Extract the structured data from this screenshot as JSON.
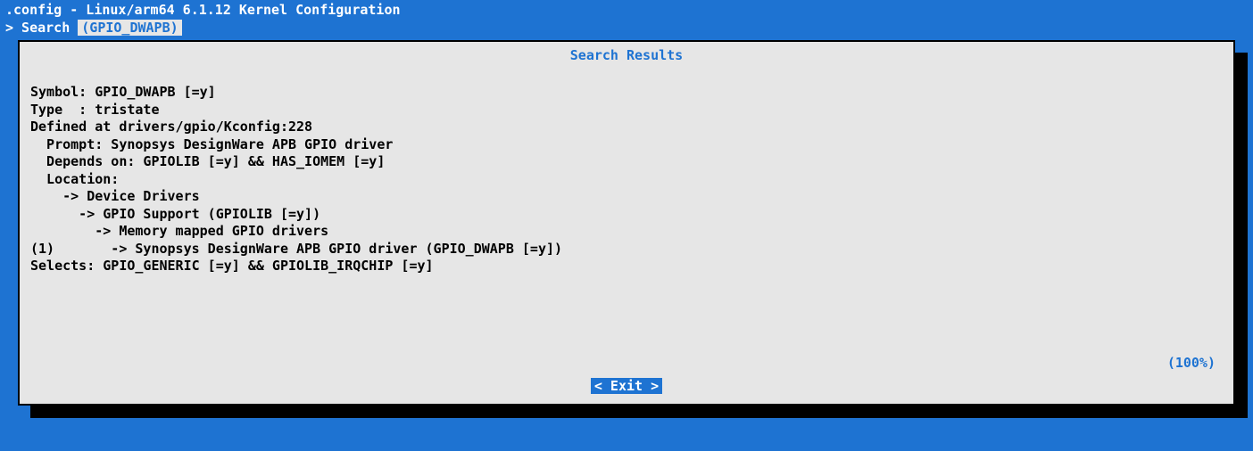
{
  "title": ".config - Linux/arm64 6.1.12 Kernel Configuration",
  "breadcrumb_prefix": "> Search ",
  "breadcrumb_tag": "(GPIO_DWAPB)",
  "dialog": {
    "title": "Search Results",
    "lines": [
      "Symbol: GPIO_DWAPB [=y]",
      "Type  : tristate",
      "Defined at drivers/gpio/Kconfig:228",
      "  Prompt: Synopsys DesignWare APB GPIO driver",
      "  Depends on: GPIOLIB [=y] && HAS_IOMEM [=y]",
      "  Location:",
      "    -> Device Drivers",
      "      -> GPIO Support (GPIOLIB [=y])",
      "        -> Memory mapped GPIO drivers",
      "(1)       -> Synopsys DesignWare APB GPIO driver (GPIO_DWAPB [=y])",
      "Selects: GPIO_GENERIC [=y] && GPIOLIB_IRQCHIP [=y]"
    ],
    "percent": "(100%)",
    "exit_label": "< Exit >"
  }
}
